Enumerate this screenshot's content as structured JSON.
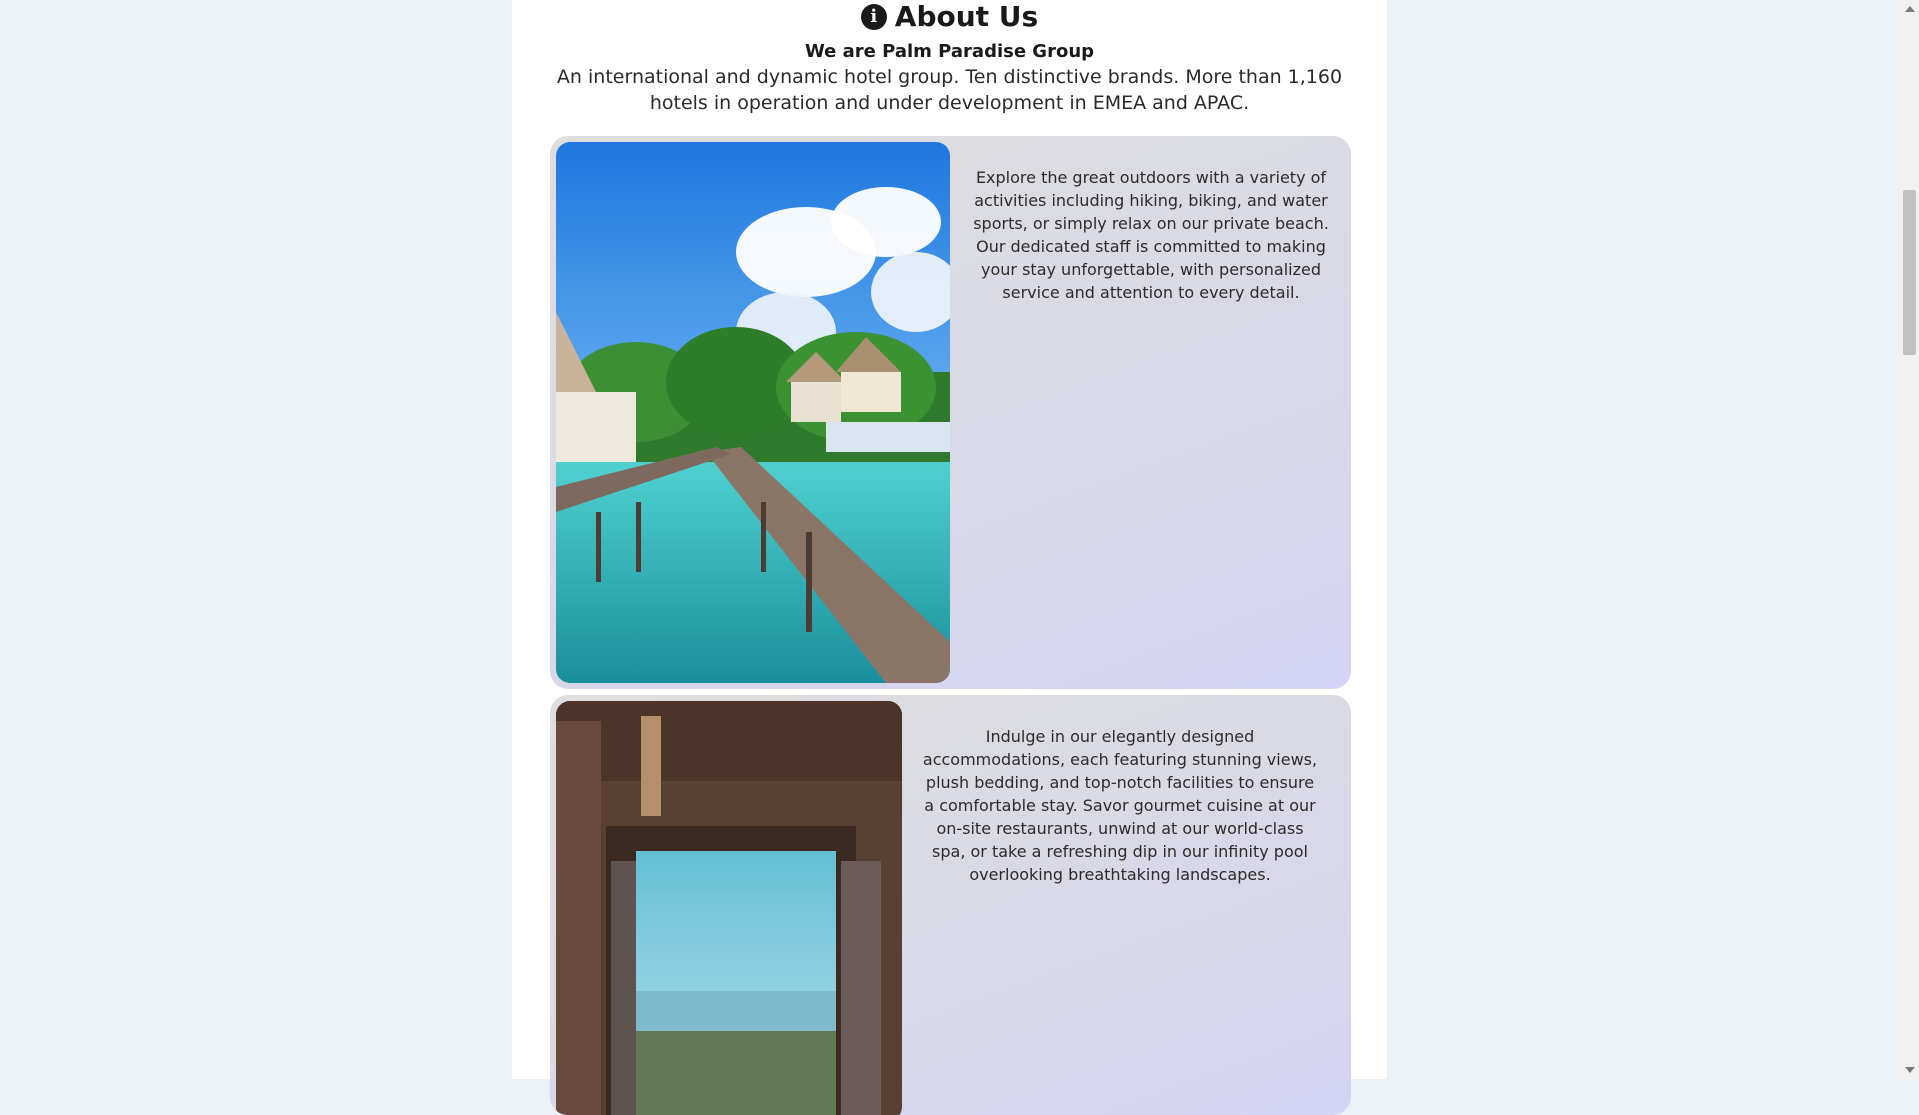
{
  "about": {
    "title": "About Us",
    "icon": "info-icon",
    "subtitle": "We are Palm Paradise Group",
    "intro": "An international and dynamic hotel group. Ten distinctive brands. More than 1,160 hotels in operation and under development in EMEA and APAC."
  },
  "cards": [
    {
      "image": "overwater-villas-boardwalk-photo",
      "text": "Explore the great outdoors with a variety of activities including hiking, biking, and water sports, or simply relax on our private beach. Our dedicated staff is committed to making your stay unforgettable, with personalized service and attention to every detail."
    },
    {
      "image": "room-ocean-view-photo",
      "text": "Indulge in our elegantly designed accommodations, each featuring stunning views, plush bedding, and top-notch facilities to ensure a comfortable stay. Savor gourmet cuisine at our on-site restaurants, unwind at our world-class spa, or take a refreshing dip in our infinity pool overlooking breathtaking landscapes."
    }
  ],
  "colors": {
    "page_background": "#edf2f8",
    "content_background": "#ffffff",
    "card_gradient_start": "#dedede",
    "card_gradient_end": "#d4d4f5"
  }
}
